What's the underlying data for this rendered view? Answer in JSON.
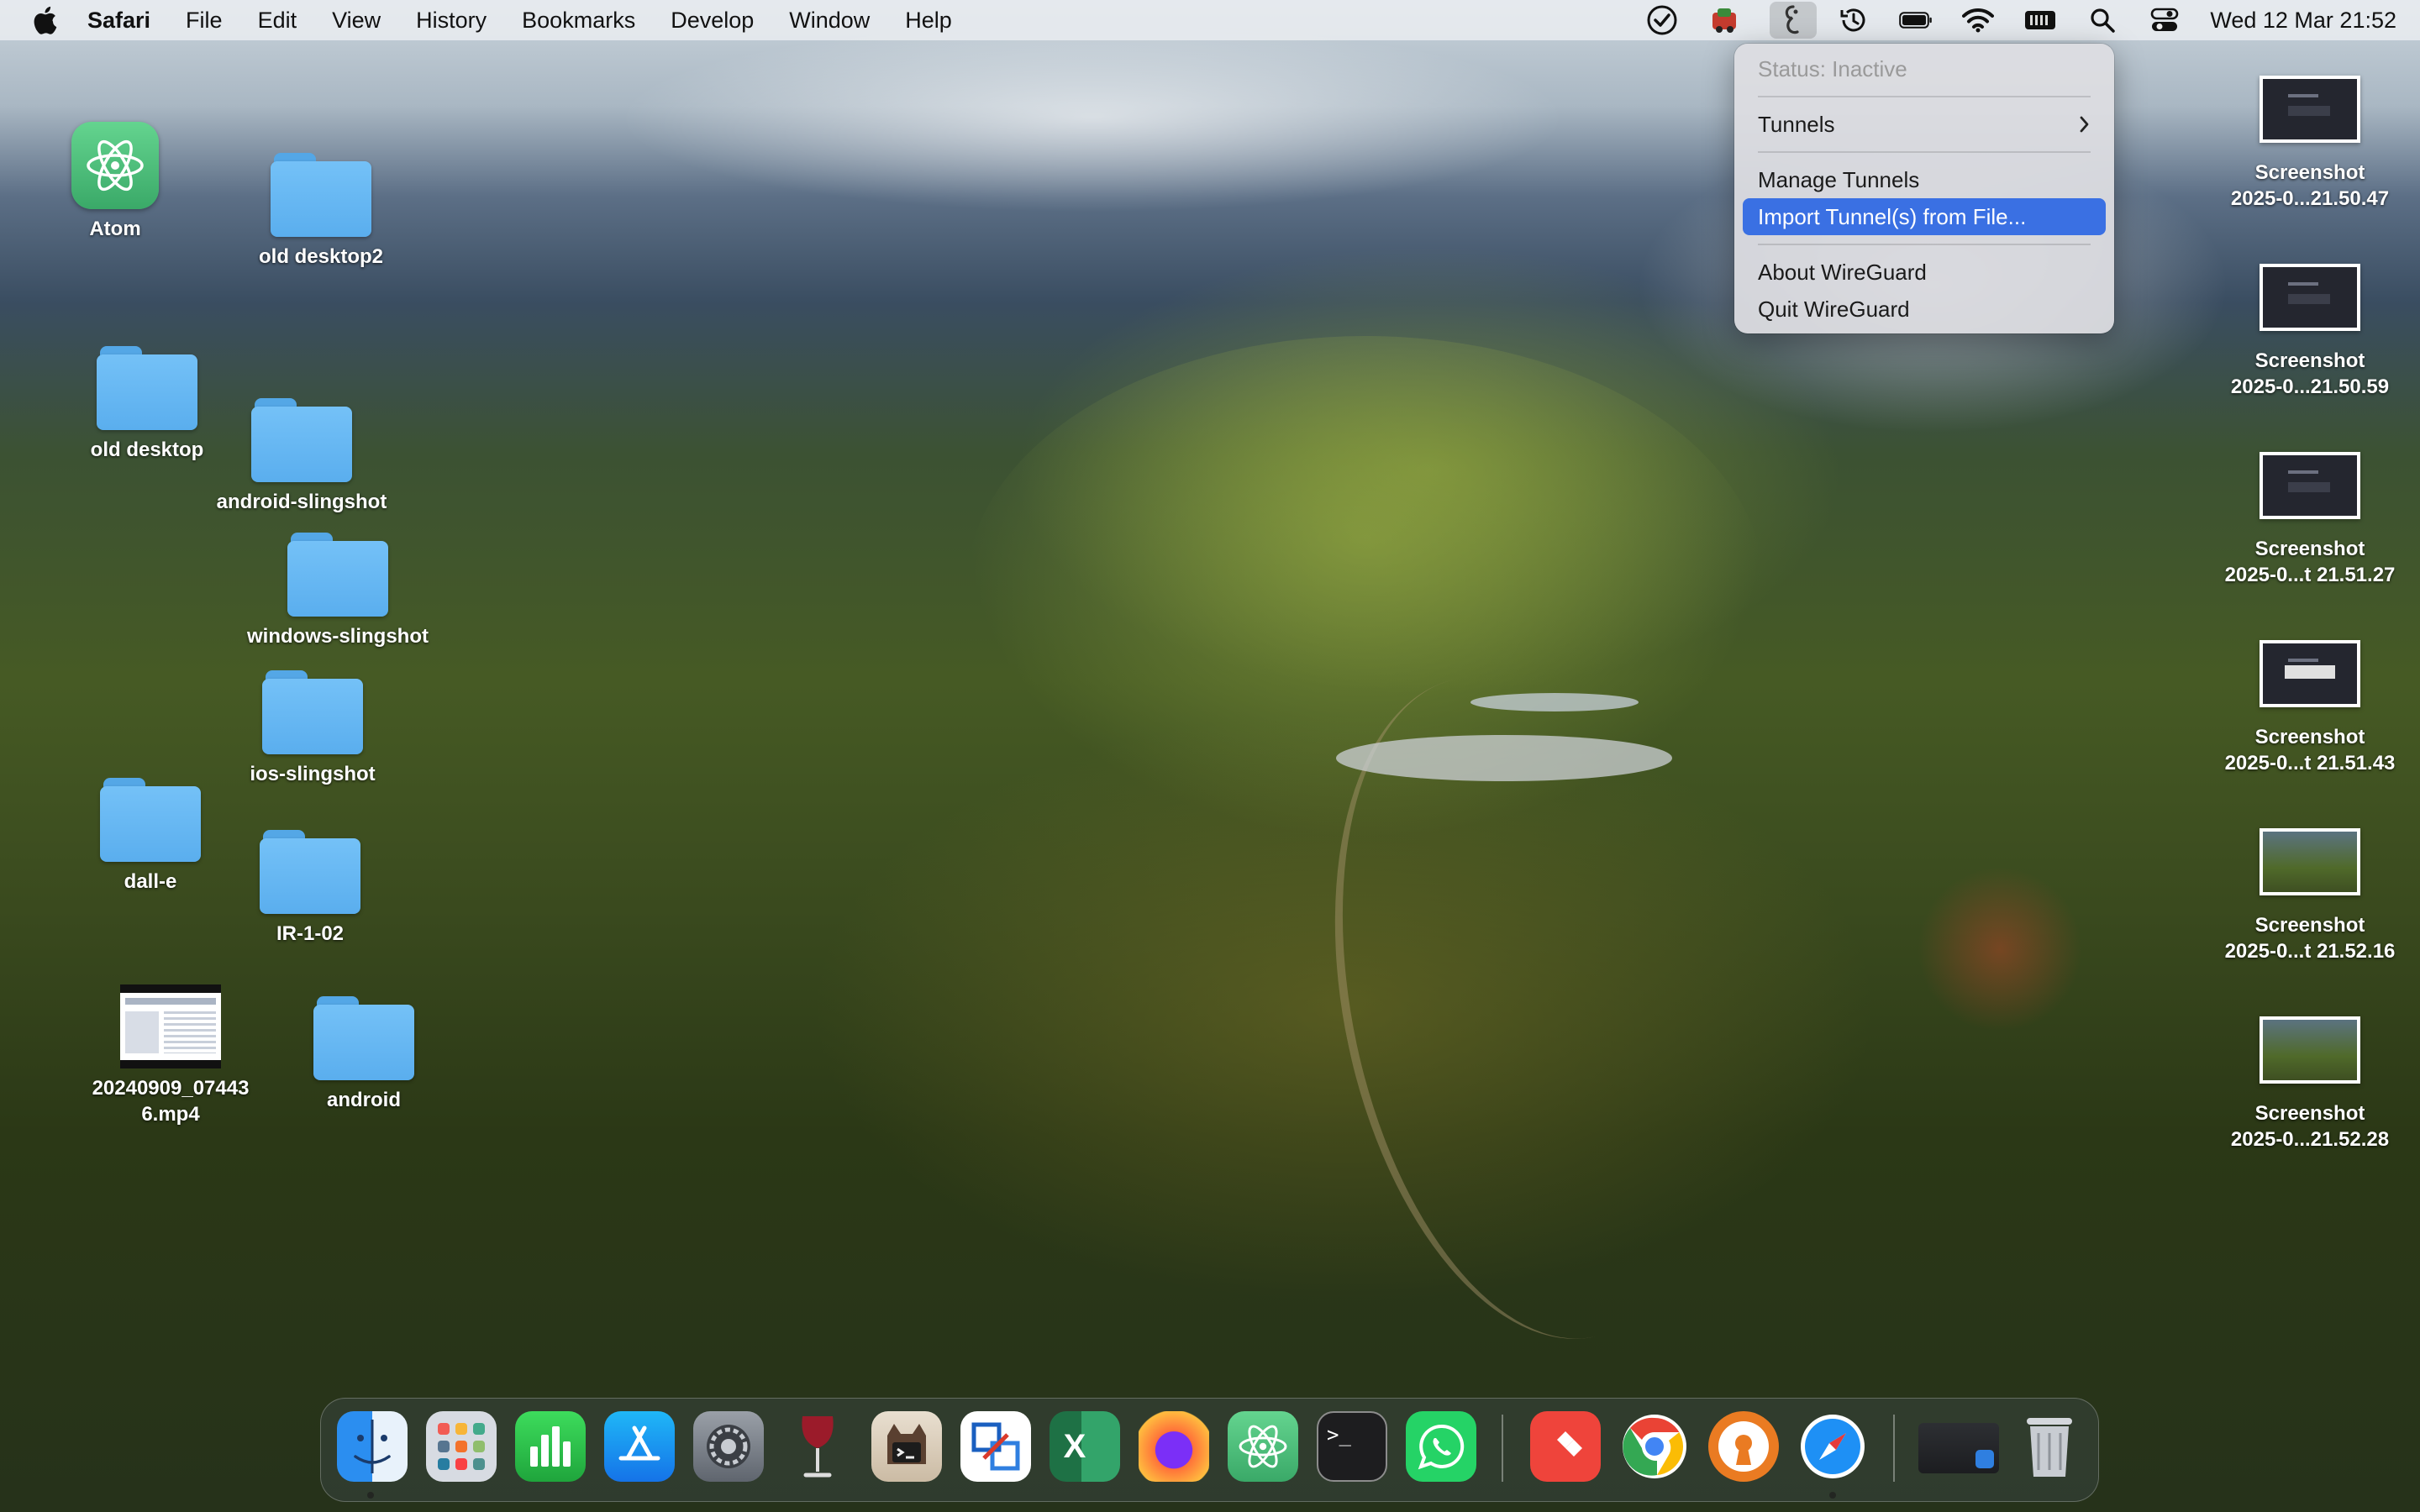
{
  "menubar": {
    "app_name": "Safari",
    "menus": [
      "File",
      "Edit",
      "View",
      "History",
      "Bookmarks",
      "Develop",
      "Window",
      "Help"
    ],
    "clock": "Wed 12 Mar  21:52"
  },
  "wireguard_menu": {
    "status": "Status: Inactive",
    "tunnels": "Tunnels",
    "manage_tunnels": "Manage Tunnels",
    "import_tunnels": "Import Tunnel(s) from File...",
    "about": "About WireGuard",
    "quit": "Quit WireGuard"
  },
  "desktop": {
    "left_icons": [
      {
        "label": "Atom"
      },
      {
        "label": "old desktop2"
      },
      {
        "label": "old desktop"
      },
      {
        "label": "android-slingshot"
      },
      {
        "label": "windows-slingshot"
      },
      {
        "label": "ios-slingshot"
      },
      {
        "label": "dall-e"
      },
      {
        "label": "IR-1-02"
      },
      {
        "label": "20240909_07443\n6.mp4"
      },
      {
        "label": "android"
      }
    ],
    "screenshots": [
      {
        "label": "Screenshot\n2025-0...21.50.47"
      },
      {
        "label": "Screenshot\n2025-0...21.50.59"
      },
      {
        "label": "Screenshot\n2025-0...t 21.51.27"
      },
      {
        "label": "Screenshot\n2025-0...t 21.51.43"
      },
      {
        "label": "Screenshot\n2025-0...t 21.52.16"
      },
      {
        "label": "Screenshot\n2025-0...21.52.28"
      }
    ]
  },
  "dock": {
    "apps": [
      "finder-icon",
      "launchpad-icon",
      "numbers-icon",
      "app-store-icon",
      "system-settings-icon",
      "wine-icon",
      "ssh-terminal-icon",
      "remote-desktop-icon",
      "excel-icon",
      "firefox-icon",
      "atom-icon",
      "terminal-icon",
      "whatsapp-icon",
      "anydesk-icon",
      "chrome-icon",
      "openvpn-icon",
      "safari-icon",
      "recent-window-icon",
      "trash-icon"
    ],
    "terminal_prompt": ">_",
    "excel_letter": "X"
  }
}
